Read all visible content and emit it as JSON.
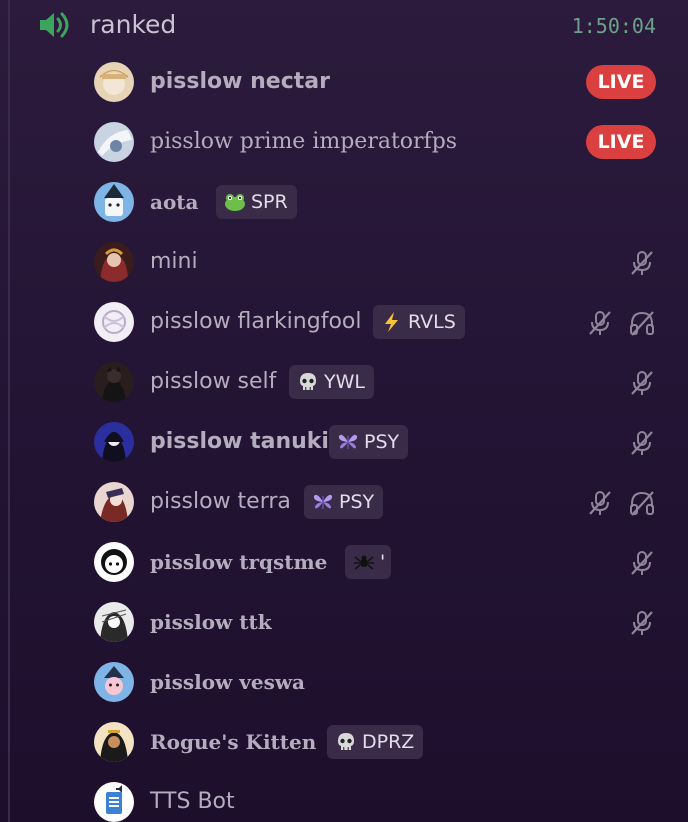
{
  "channel": {
    "name": "ranked",
    "elapsed": "1:50:04",
    "icon": "speaker-icon"
  },
  "live_label": "LIVE",
  "members": [
    {
      "name": "pisslow nectar",
      "live": true
    },
    {
      "name": "pisslow prime imperatorfps",
      "live": true
    },
    {
      "name": "aota",
      "tag": {
        "emoji": "frog",
        "label": "SPR"
      }
    },
    {
      "name": "mini",
      "muted": true
    },
    {
      "name": "pisslow flarkingfool",
      "tag": {
        "emoji": "lightning",
        "label": "RVLS"
      },
      "muted": true,
      "deafened": true
    },
    {
      "name": "pisslow self",
      "tag": {
        "emoji": "skull",
        "label": "YWL"
      },
      "muted": true
    },
    {
      "name": "pisslow tanuki",
      "tag": {
        "emoji": "butterfly",
        "label": "PSY"
      },
      "muted": true
    },
    {
      "name": "pisslow terra",
      "tag": {
        "emoji": "butterfly",
        "label": "PSY"
      },
      "muted": true,
      "deafened": true
    },
    {
      "name": "pisslow trqstme",
      "tag": {
        "emoji": "spider",
        "label": "'"
      },
      "muted": true
    },
    {
      "name": "pisslow ttk",
      "muted": true
    },
    {
      "name": "pisslow veswa"
    },
    {
      "name": "Rogue's Kitten",
      "tag": {
        "emoji": "skull",
        "label": "DPRZ"
      }
    },
    {
      "name": "TTS Bot"
    }
  ],
  "colors": {
    "live": "#d9403f",
    "timer": "#6ca08a",
    "speaker": "#3ba55d"
  }
}
